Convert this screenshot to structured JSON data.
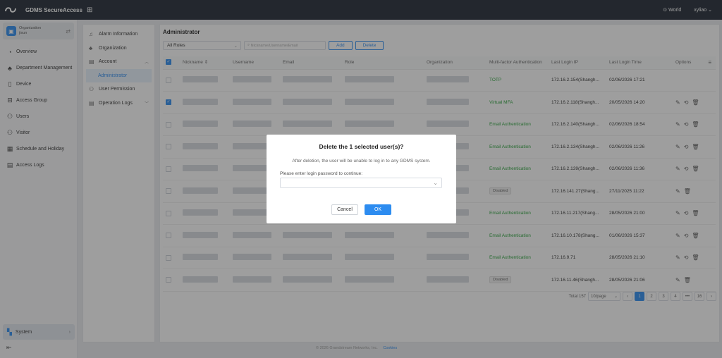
{
  "topbar": {
    "app_name": "GDMS SecureAccess",
    "region": "World",
    "user": "xyliao"
  },
  "sidebar": {
    "org_label": "Organization",
    "org_name": "jisun",
    "items": [
      {
        "label": "Overview",
        "icon": "overview-icon"
      },
      {
        "label": "Department Management",
        "icon": "department-icon"
      },
      {
        "label": "Device",
        "icon": "device-icon"
      },
      {
        "label": "Access Group",
        "icon": "access-group-icon"
      },
      {
        "label": "Users",
        "icon": "users-icon"
      },
      {
        "label": "Visitor",
        "icon": "visitor-icon"
      },
      {
        "label": "Schedule and Holiday",
        "icon": "calendar-icon"
      },
      {
        "label": "Access Logs",
        "icon": "logs-icon"
      }
    ],
    "system_label": "System"
  },
  "subnav": {
    "items": [
      {
        "label": "Alarm Information"
      },
      {
        "label": "Organization"
      },
      {
        "label": "Account"
      },
      {
        "label": "Administrator"
      },
      {
        "label": "User Permission"
      },
      {
        "label": "Operation Logs"
      }
    ]
  },
  "main": {
    "title": "Administrator",
    "role_filter": "All Roles",
    "search_placeholder": "Nickname/Username/Email",
    "add_label": "Add",
    "delete_label": "Delete",
    "columns": [
      "Nickname",
      "Username",
      "Email",
      "Role",
      "Organization",
      "Multi-factor Authentication",
      "Last Login IP",
      "Last Login Time",
      "Options"
    ],
    "rows": [
      {
        "mfa": "TOTP",
        "ip": "172.16.2.154(Shangh...",
        "time": "02/06/2026 17:21",
        "checked": false,
        "opts": 0
      },
      {
        "mfa": "Virtual MFA",
        "ip": "172.16.2.118(Shangh...",
        "time": "20/05/2026 14:20",
        "checked": true,
        "opts": 3
      },
      {
        "mfa": "Email Authentication",
        "ip": "172.16.2.140(Shangh...",
        "time": "02/06/2026 18:54",
        "checked": false,
        "opts": 3
      },
      {
        "mfa": "Email Authentication",
        "ip": "172.16.2.134(Shangh...",
        "time": "02/06/2026 11:26",
        "checked": false,
        "opts": 3
      },
      {
        "mfa": "Email Authentication",
        "ip": "172.16.2.139(Shangh...",
        "time": "02/06/2026 11:36",
        "checked": false,
        "opts": 3
      },
      {
        "mfa": "Disabled",
        "ip": "172.16.141.27(Shang...",
        "time": "27/11/2025 11:22",
        "checked": false,
        "opts": 2
      },
      {
        "mfa": "Email Authentication",
        "ip": "172.16.11.217(Shang...",
        "time": "28/05/2026 21:00",
        "checked": false,
        "opts": 3
      },
      {
        "mfa": "Email Authentication",
        "ip": "172.16.10.178(Shang...",
        "time": "01/06/2026 15:37",
        "checked": false,
        "opts": 3
      },
      {
        "mfa": "Email Authentication",
        "ip": "172.16.9.71",
        "time": "28/05/2026 21:10",
        "checked": false,
        "opts": 3
      },
      {
        "mfa": "Disabled",
        "ip": "172.16.11.46(Shangh...",
        "time": "28/05/2026 21:06",
        "checked": false,
        "opts": 2
      }
    ],
    "pagination": {
      "total": "Total 157",
      "page_size": "10/page",
      "pages": [
        "1",
        "2",
        "3",
        "4",
        "•••",
        "16"
      ]
    }
  },
  "footer": {
    "copyright": "© 2026 Grandstream Networks, Inc.",
    "cookies": "Cookies"
  },
  "modal": {
    "title": "Delete the 1 selected user(s)?",
    "description": "After deletion, the user will be unable to log in to any GDMS system.",
    "password_label": "Please enter login password to continue:",
    "cancel_label": "Cancel",
    "ok_label": "OK"
  },
  "colors": {
    "accent": "#2d8cf0",
    "topbar": "#1f2733",
    "success": "#2aa33b"
  }
}
